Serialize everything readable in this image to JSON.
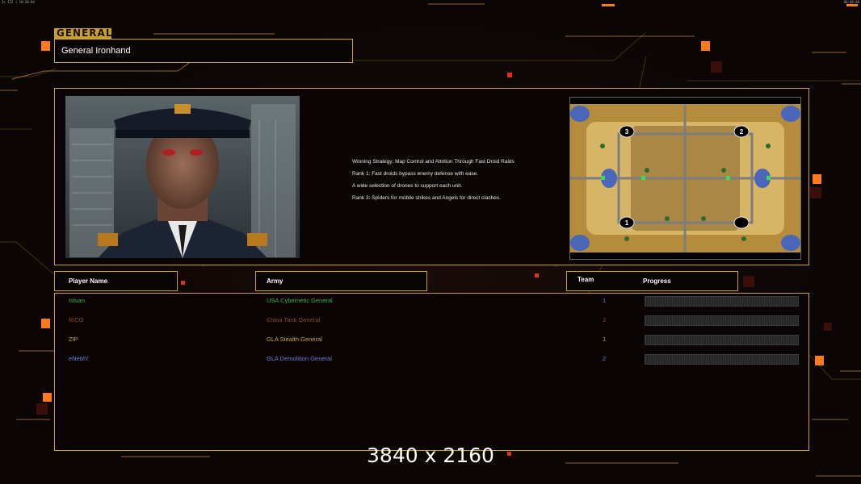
{
  "status_bar": {
    "left": "3× 122 | 10:20:84",
    "right": "00:00:00"
  },
  "section_label": "GENERAL",
  "general_name": "General Ironhand",
  "strategy": [
    "Winning Strategy: Map Control and Attrition Through Fast Droid Raids",
    "Rank 1: Fast droids bypass enemy defense with ease.",
    "A wide selection of drones to support each unit.",
    "Rank 3: Spiders for mobile strikes and Angels for direct clashes."
  ],
  "map": {
    "spawn_numbers": [
      "3",
      "2",
      "1",
      ""
    ]
  },
  "headers": {
    "player": "Player Name",
    "army": "Army",
    "team": "Team",
    "progress": "Progress"
  },
  "players": [
    {
      "name": "Istvan",
      "army": "USA Cybernetic General",
      "team": "1",
      "progress": 0,
      "color": "#3fb043"
    },
    {
      "name": "RiCO",
      "army": "China Tank General",
      "team": "2",
      "progress": 0,
      "color": "#8a4a2a"
    },
    {
      "name": "ZIP",
      "army": "GLA Stealth General",
      "team": "1",
      "progress": 0,
      "color": "#c8a64a"
    },
    {
      "name": "eNeMY",
      "army": "GLA Demolition General",
      "team": "2",
      "progress": 0,
      "color": "#6a7adf"
    }
  ],
  "resolution_label": "3840 x 2160",
  "colors": {
    "accent": "#c9a227",
    "background": "#0b0605",
    "neon": "#ff7a1a"
  }
}
